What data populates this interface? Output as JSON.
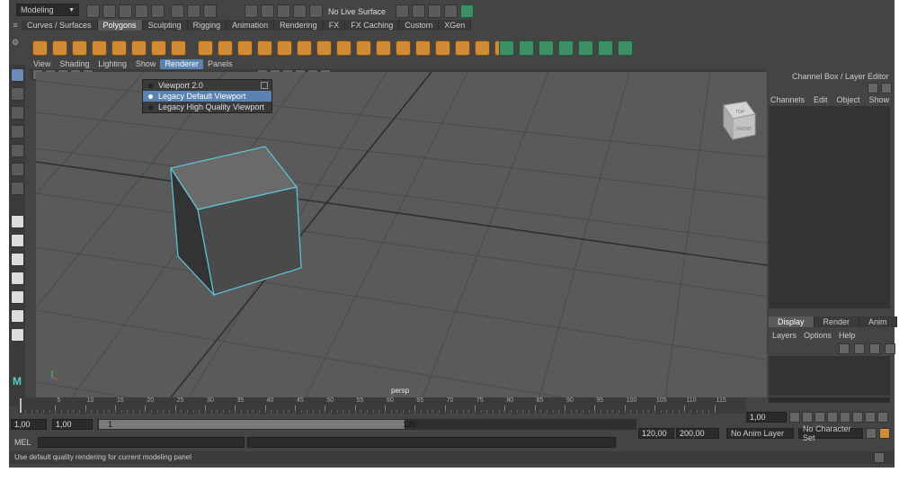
{
  "top": {
    "mode_select": "Modeling",
    "live_surface": "No Live Surface"
  },
  "shelf_tabs": [
    {
      "label": "Curves / Surfaces",
      "active": false
    },
    {
      "label": "Polygons",
      "active": true
    },
    {
      "label": "Sculpting",
      "active": false
    },
    {
      "label": "Rigging",
      "active": false
    },
    {
      "label": "Animation",
      "active": false
    },
    {
      "label": "Rendering",
      "active": false
    },
    {
      "label": "FX",
      "active": false
    },
    {
      "label": "FX Caching",
      "active": false
    },
    {
      "label": "Custom",
      "active": false
    },
    {
      "label": "XGen",
      "active": false
    }
  ],
  "panel_menu": [
    "View",
    "Shading",
    "Lighting",
    "Show",
    "Renderer",
    "Panels"
  ],
  "renderer_dropdown": {
    "items": [
      {
        "label": "Viewport 2.0"
      },
      {
        "label": "Legacy Default Viewport"
      },
      {
        "label": "Legacy High Quality Viewport"
      }
    ]
  },
  "viewport": {
    "camera_label": "persp",
    "viewcube_top": "TOP",
    "viewcube_front": "FRONT"
  },
  "channel_box": {
    "title": "Channel Box / Layer Editor",
    "tabs": [
      "Channels",
      "Edit",
      "Object",
      "Show"
    ]
  },
  "layer_editor": {
    "tabs": [
      "Display",
      "Render",
      "Anim"
    ],
    "menus": [
      "Layers",
      "Options",
      "Help"
    ]
  },
  "timeline": {
    "ticks": [
      "5",
      "10",
      "15",
      "20",
      "25",
      "30",
      "35",
      "40",
      "45",
      "50",
      "55",
      "60",
      "65",
      "70",
      "75",
      "80",
      "85",
      "90",
      "95",
      "100",
      "105",
      "110",
      "115"
    ],
    "current_frame": "1,00"
  },
  "range": {
    "start": "1,00",
    "playback_start": "1,00",
    "slider_start": "1",
    "slider_end": "120",
    "playback_end": "120,00",
    "end": "200,00",
    "anim_layer": "No Anim Layer",
    "character_set": "No Character Set"
  },
  "command": {
    "label": "MEL"
  },
  "help_line": "Use default quality rendering for current modeling panel",
  "colors": {
    "accent": "#5a83b1",
    "selection_cyan": "#5ec8d8",
    "shelf_orange": "#d18a35"
  }
}
